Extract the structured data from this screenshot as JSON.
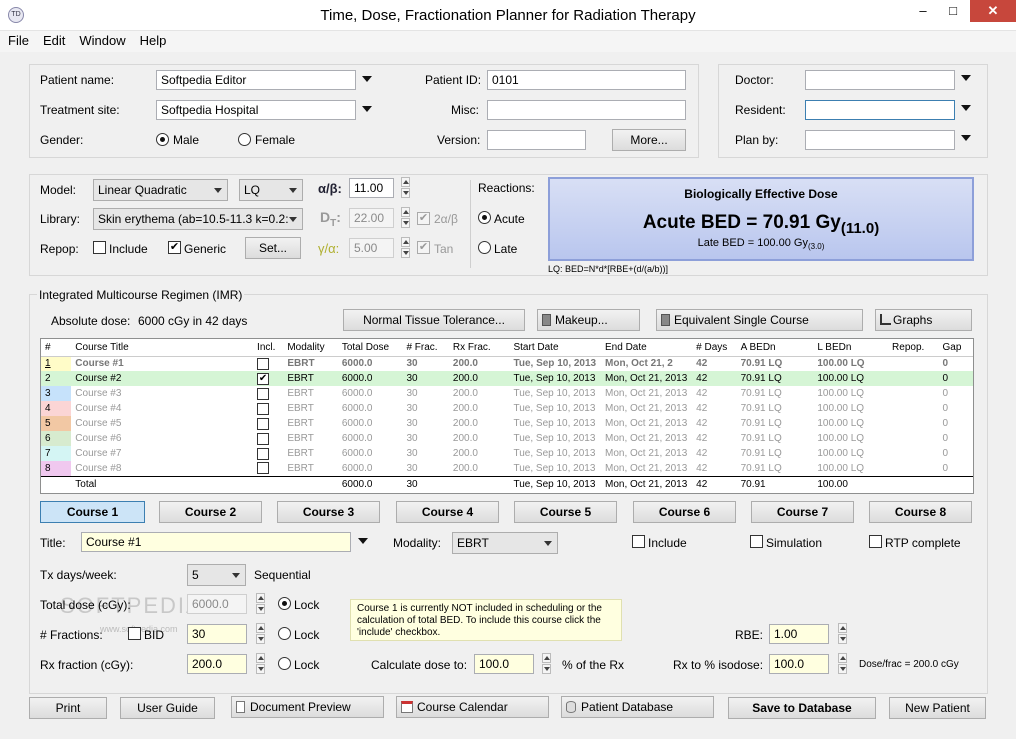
{
  "window": {
    "title": "Time, Dose, Fractionation Planner for Radiation Therapy",
    "minimize": "–",
    "maximize": "□",
    "close": "✕",
    "app_icon": "app-logo-icon"
  },
  "menu": [
    "File",
    "Edit",
    "Window",
    "Help"
  ],
  "patient": {
    "name_label": "Patient name:",
    "name": "Softpedia Editor",
    "site_label": "Treatment site:",
    "site": "Softpedia Hospital",
    "gender_label": "Gender:",
    "male": "Male",
    "female": "Female",
    "id_label": "Patient ID:",
    "id": "0101",
    "misc_label": "Misc:",
    "misc": "",
    "version_label": "Version:",
    "version": "",
    "more_button": "More..."
  },
  "staff": {
    "doctor_label": "Doctor:",
    "doctor": "",
    "resident_label": "Resident:",
    "resident": "",
    "planby_label": "Plan by:",
    "planby": ""
  },
  "model": {
    "model_label": "Model:",
    "model": "Linear Quadratic",
    "model_abbr": "LQ",
    "library_label": "Library:",
    "library": "Skin erythema (ab=10.5-11.3 k=0.2:",
    "repop_label": "Repop:",
    "include": "Include",
    "generic": "Generic",
    "set_button": "Set...",
    "ab_label": "α/β:",
    "ab": "11.00",
    "dt_label": "D",
    "dt_sub": "T",
    "dt_suffix": ":",
    "dt": "22.00",
    "two_ab": "2α/β",
    "ga_label": "γ/α:",
    "ga": "5.00",
    "tan": "Tan",
    "reactions_label": "Reactions:",
    "acute": "Acute",
    "late": "Late"
  },
  "bed": {
    "header": "Biologically Effective Dose",
    "main": "Acute BED = 70.91 Gy",
    "main_sub": "(11.0)",
    "late": "Late BED = 100.00 Gy",
    "late_sub": "(3.0)",
    "formula": "LQ: BED=N*d*[RBE+(d/(a/b))]"
  },
  "imr": {
    "group_label": "Integrated Multicourse Regimen (IMR)",
    "absolute_label": "Absolute dose:",
    "absolute_value": "6000 cGy in 42 days",
    "ntt_button": "Normal Tissue Tolerance...",
    "makeup_button": "Makeup...",
    "esc_button": "Equivalent Single Course",
    "graphs_button": "Graphs"
  },
  "table": {
    "headers": [
      "#",
      "Course Title",
      "Incl.",
      "Modality",
      "Total Dose",
      "# Frac.",
      "Rx Frac.",
      "Start Date",
      "End Date",
      "# Days",
      "A BEDn",
      "L BEDn",
      "Repop.",
      "Gap"
    ],
    "swatches": [
      "#fffcc8",
      "#d5f5d5",
      "#c6e2fb",
      "#fbd5d5",
      "#f2c8a4",
      "#d7ebcf",
      "#d4f5f4",
      "#f0c8ef"
    ],
    "rows": [
      [
        "1",
        "Course #1",
        "",
        "EBRT",
        "6000.0",
        "30",
        "200.0",
        "Tue, Sep 10, 2013",
        "Mon, Oct 21, 2",
        "42",
        "70.91  LQ",
        "100.00  LQ",
        "",
        "0"
      ],
      [
        "2",
        "Course #2",
        "✔",
        "EBRT",
        "6000.0",
        "30",
        "200.0",
        "Tue, Sep 10, 2013",
        "Mon, Oct 21, 2013",
        "42",
        "70.91  LQ",
        "100.00  LQ",
        "",
        "0"
      ],
      [
        "3",
        "Course #3",
        "",
        "EBRT",
        "6000.0",
        "30",
        "200.0",
        "Tue, Sep 10, 2013",
        "Mon, Oct 21, 2013",
        "42",
        "70.91  LQ",
        "100.00  LQ",
        "",
        "0"
      ],
      [
        "4",
        "Course #4",
        "",
        "EBRT",
        "6000.0",
        "30",
        "200.0",
        "Tue, Sep 10, 2013",
        "Mon, Oct 21, 2013",
        "42",
        "70.91  LQ",
        "100.00  LQ",
        "",
        "0"
      ],
      [
        "5",
        "Course #5",
        "",
        "EBRT",
        "6000.0",
        "30",
        "200.0",
        "Tue, Sep 10, 2013",
        "Mon, Oct 21, 2013",
        "42",
        "70.91  LQ",
        "100.00  LQ",
        "",
        "0"
      ],
      [
        "6",
        "Course #6",
        "",
        "EBRT",
        "6000.0",
        "30",
        "200.0",
        "Tue, Sep 10, 2013",
        "Mon, Oct 21, 2013",
        "42",
        "70.91  LQ",
        "100.00  LQ",
        "",
        "0"
      ],
      [
        "7",
        "Course #7",
        "",
        "EBRT",
        "6000.0",
        "30",
        "200.0",
        "Tue, Sep 10, 2013",
        "Mon, Oct 21, 2013",
        "42",
        "70.91  LQ",
        "100.00  LQ",
        "",
        "0"
      ],
      [
        "8",
        "Course #8",
        "",
        "EBRT",
        "6000.0",
        "30",
        "200.0",
        "Tue, Sep 10, 2013",
        "Mon, Oct 21, 2013",
        "42",
        "70.91  LQ",
        "100.00  LQ",
        "",
        "0"
      ]
    ],
    "total": [
      "",
      "Total",
      "",
      "",
      "6000.0",
      "30",
      "",
      "Tue, Sep 10, 2013",
      "Mon, Oct 21, 2013",
      "42",
      "70.91",
      "100.00",
      "",
      ""
    ]
  },
  "course_tabs": [
    "Course 1",
    "Course 2",
    "Course 3",
    "Course 4",
    "Course 5",
    "Course 6",
    "Course 7",
    "Course 8"
  ],
  "course": {
    "title_label": "Title:",
    "title": "Course #1",
    "modality_label": "Modality:",
    "modality": "EBRT",
    "include": "Include",
    "simulation": "Simulation",
    "rtp": "RTP complete",
    "tx_label": "Tx days/week:",
    "tx_days": "5",
    "sequential": "Sequential",
    "total_label": "Total dose (cGy):",
    "total_dose": "6000.0",
    "lock": "Lock",
    "frac_label": "# Fractions:",
    "bid": "BID",
    "fractions": "30",
    "rxfrac_label": "Rx fraction (cGy):",
    "rx_fraction": "200.0",
    "note": "Course 1 is currently NOT included in scheduling or the calculation of total BED. To include this course click the 'include' checkbox.",
    "calc_label": "Calculate dose to:",
    "calc_value": "100.0",
    "pct_rx": "% of the Rx",
    "rbe_label": "RBE:",
    "rbe": "1.00",
    "isodose_label": "Rx to % isodose:",
    "isodose": "100.0",
    "dose_frac": "Dose/frac = 200.0 cGy"
  },
  "watermark": {
    "text": "SOFTPEDIA",
    "url": "www.softpedia.com"
  },
  "footer": {
    "print": "Print",
    "guide": "User Guide",
    "preview": "Document Preview",
    "calendar": "Course Calendar",
    "database": "Patient Database",
    "save": "Save to Database",
    "new": "New Patient"
  }
}
